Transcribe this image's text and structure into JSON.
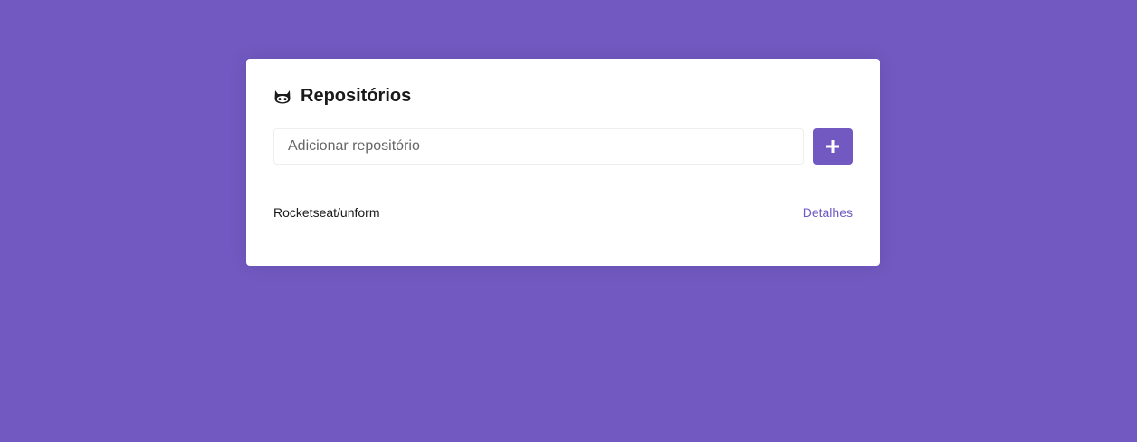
{
  "header": {
    "icon": "github-icon",
    "title": "Repositórios"
  },
  "form": {
    "placeholder": "Adicionar repositório",
    "value": "",
    "submit_icon": "plus-icon"
  },
  "repositories": [
    {
      "name": "Rocketseat/unform",
      "link_label": "Detalhes"
    }
  ],
  "colors": {
    "accent": "#7159c1",
    "background": "#7159c1",
    "card": "#ffffff"
  }
}
